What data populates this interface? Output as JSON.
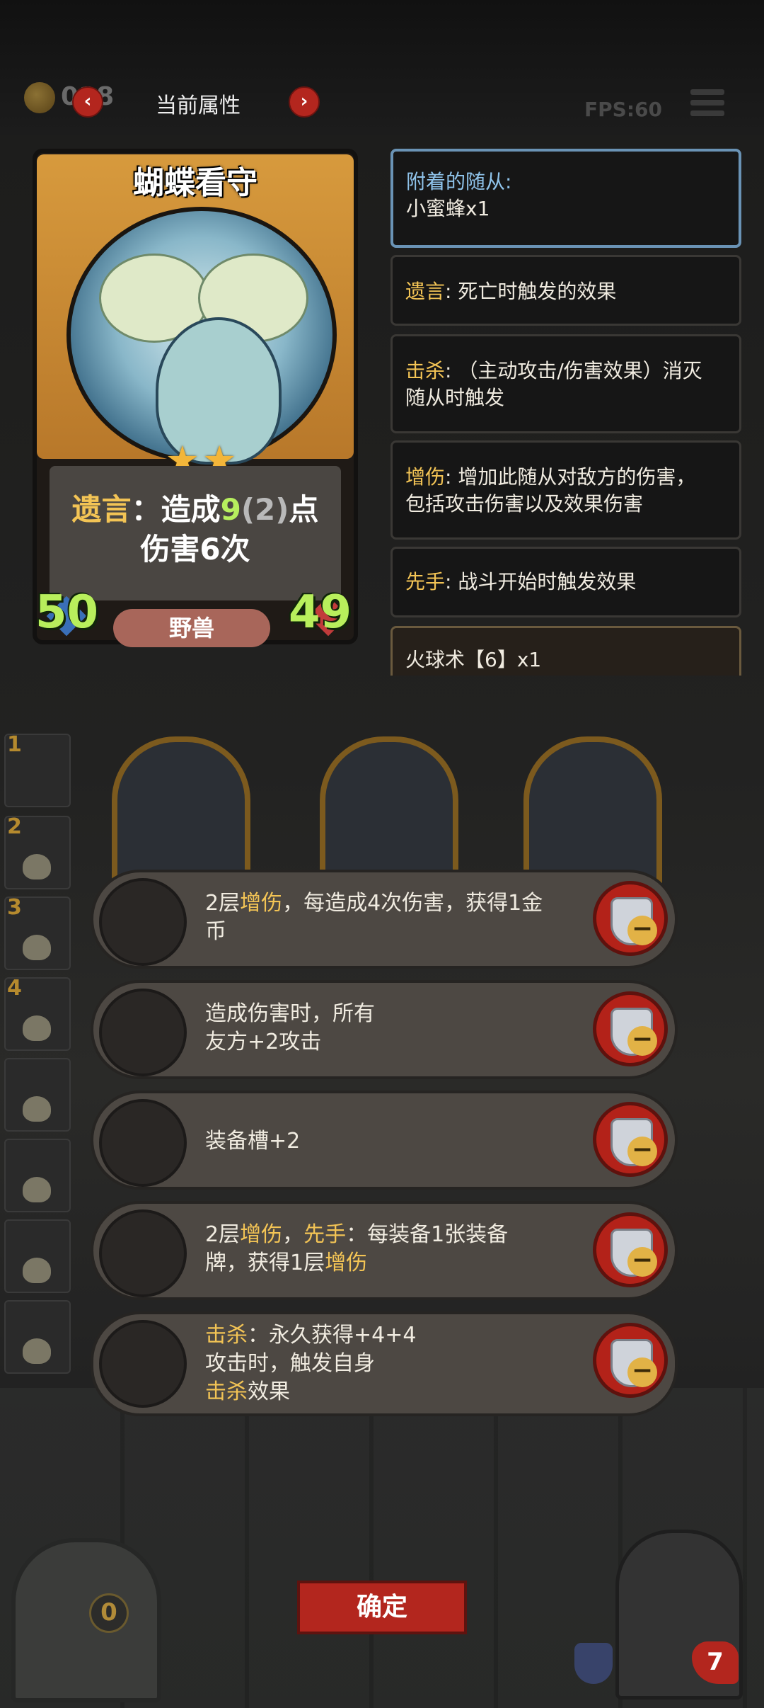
{
  "topbar": {
    "coin_value": "018",
    "title": "当前属性",
    "prev_icon": "‹",
    "next_icon": "›",
    "fps": "FPS:60"
  },
  "card": {
    "name": "蝴蝶看守",
    "stars": "★★",
    "text_keyword": "遗言",
    "text_pre": "：造成",
    "text_value": "9",
    "text_base": "(2)",
    "text_post": "点",
    "text_line2": "伤害6次",
    "attack": "50",
    "health": "49",
    "tribe": "野兽"
  },
  "panels": {
    "attached_label": "附着的随从:",
    "attached_value": "小蜜蜂x1",
    "deathrattle_kw": "遗言",
    "deathrattle_desc": ": 死亡时触发的效果",
    "kill_kw": "击杀",
    "kill_desc_1": ": （主动攻击/伤害效果）消灭",
    "kill_desc_2": "随从时触发",
    "boost_kw": "增伤",
    "boost_desc_1": ": 增加此随从对敌方的伤害，",
    "boost_desc_2": "包括攻击伤害以及效果伤害",
    "first_kw": "先手",
    "first_desc": ": 战斗开始时触发效果",
    "spell": "火球术【6】x1"
  },
  "side_cards": [
    "1",
    "2",
    "3",
    "4"
  ],
  "buffs": [
    {
      "a": "2层",
      "kw1": "增伤",
      "b": "，每造成4次伤害，获得1金",
      "line2": "币"
    },
    {
      "line1": "造成伤害时，所有",
      "line2": "友方+2攻击"
    },
    {
      "line1": "装备槽+2"
    },
    {
      "a": "2层",
      "kw1": "增伤",
      "sep": "，",
      "kw2": "先手",
      "b": "：每装备1张装备",
      "line2a": "牌，获得1层",
      "line2kw": "增伤"
    },
    {
      "kw1": "击杀",
      "b": "：永久获得+4+4",
      "line2": "攻击时，触发自身",
      "line3kw": "击杀",
      "line3": "效果"
    }
  ],
  "bottom": {
    "confirm": "确定",
    "shop_count": "0",
    "hero_hp": "7"
  },
  "colors": {
    "keyword": "#f3c455",
    "confirm_button": "#b3261e",
    "stat_green": "#b6ef5e",
    "attached_border": "#6a93b5"
  },
  "icons": [
    "coin-icon",
    "menu-icon",
    "star-icon",
    "shield-remove-icon",
    "shop-door-icon",
    "hero-portrait",
    "skull-icon"
  ]
}
